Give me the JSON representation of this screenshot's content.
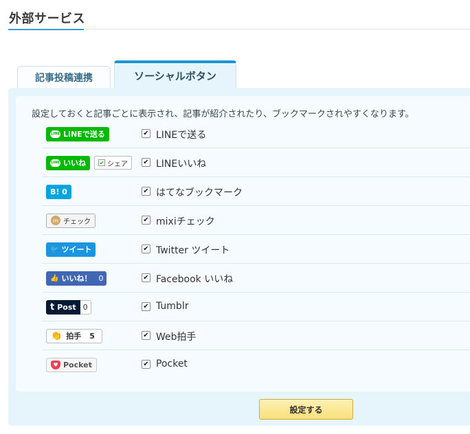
{
  "page": {
    "title": "外部サービス"
  },
  "tabs": [
    {
      "label": "記事投稿連携",
      "active": false
    },
    {
      "label": "ソーシャルボタン",
      "active": true
    }
  ],
  "panel": {
    "description": "設定しておくと記事ごとに表示され、記事が紹介されたり、ブックマークされやすくなります。"
  },
  "services": [
    {
      "badge": "LINEで送る",
      "icon": "line-icon",
      "icon_text": "LINE",
      "label": "LINEで送る",
      "checked": true
    },
    {
      "badge": "いいね",
      "icon": "line-icon",
      "icon_text": "LINE",
      "extra": "シェア",
      "label": "LINEいいね",
      "checked": true
    },
    {
      "badge": "B! 0",
      "icon": "hatena-icon",
      "label": "はてなブックマーク",
      "checked": true
    },
    {
      "badge": "チェック",
      "icon": "mixi-icon",
      "icon_text": "m",
      "label": "mixiチェック",
      "checked": true
    },
    {
      "badge": "ツイート",
      "icon": "twitter-bird-icon",
      "icon_text": "🐦",
      "label": "Twitter ツイート",
      "checked": true
    },
    {
      "badge": "いいね！",
      "icon": "thumbs-up-icon",
      "icon_text": "👍",
      "count": "0",
      "label": "Facebook いいね",
      "checked": true
    },
    {
      "badge": "Post",
      "icon": "tumblr-icon",
      "icon_text": "t",
      "count": "0",
      "label": "Tumblr",
      "checked": true
    },
    {
      "badge": "拍手",
      "icon": "clap-hand-icon",
      "icon_text": "👏",
      "count": "5",
      "label": "Web拍手",
      "checked": true
    },
    {
      "badge": "Pocket",
      "icon": "pocket-icon",
      "icon_text": "♥",
      "label": "Pocket",
      "checked": true
    }
  ],
  "checkmark": "✔",
  "submit": {
    "label": "設定する"
  }
}
